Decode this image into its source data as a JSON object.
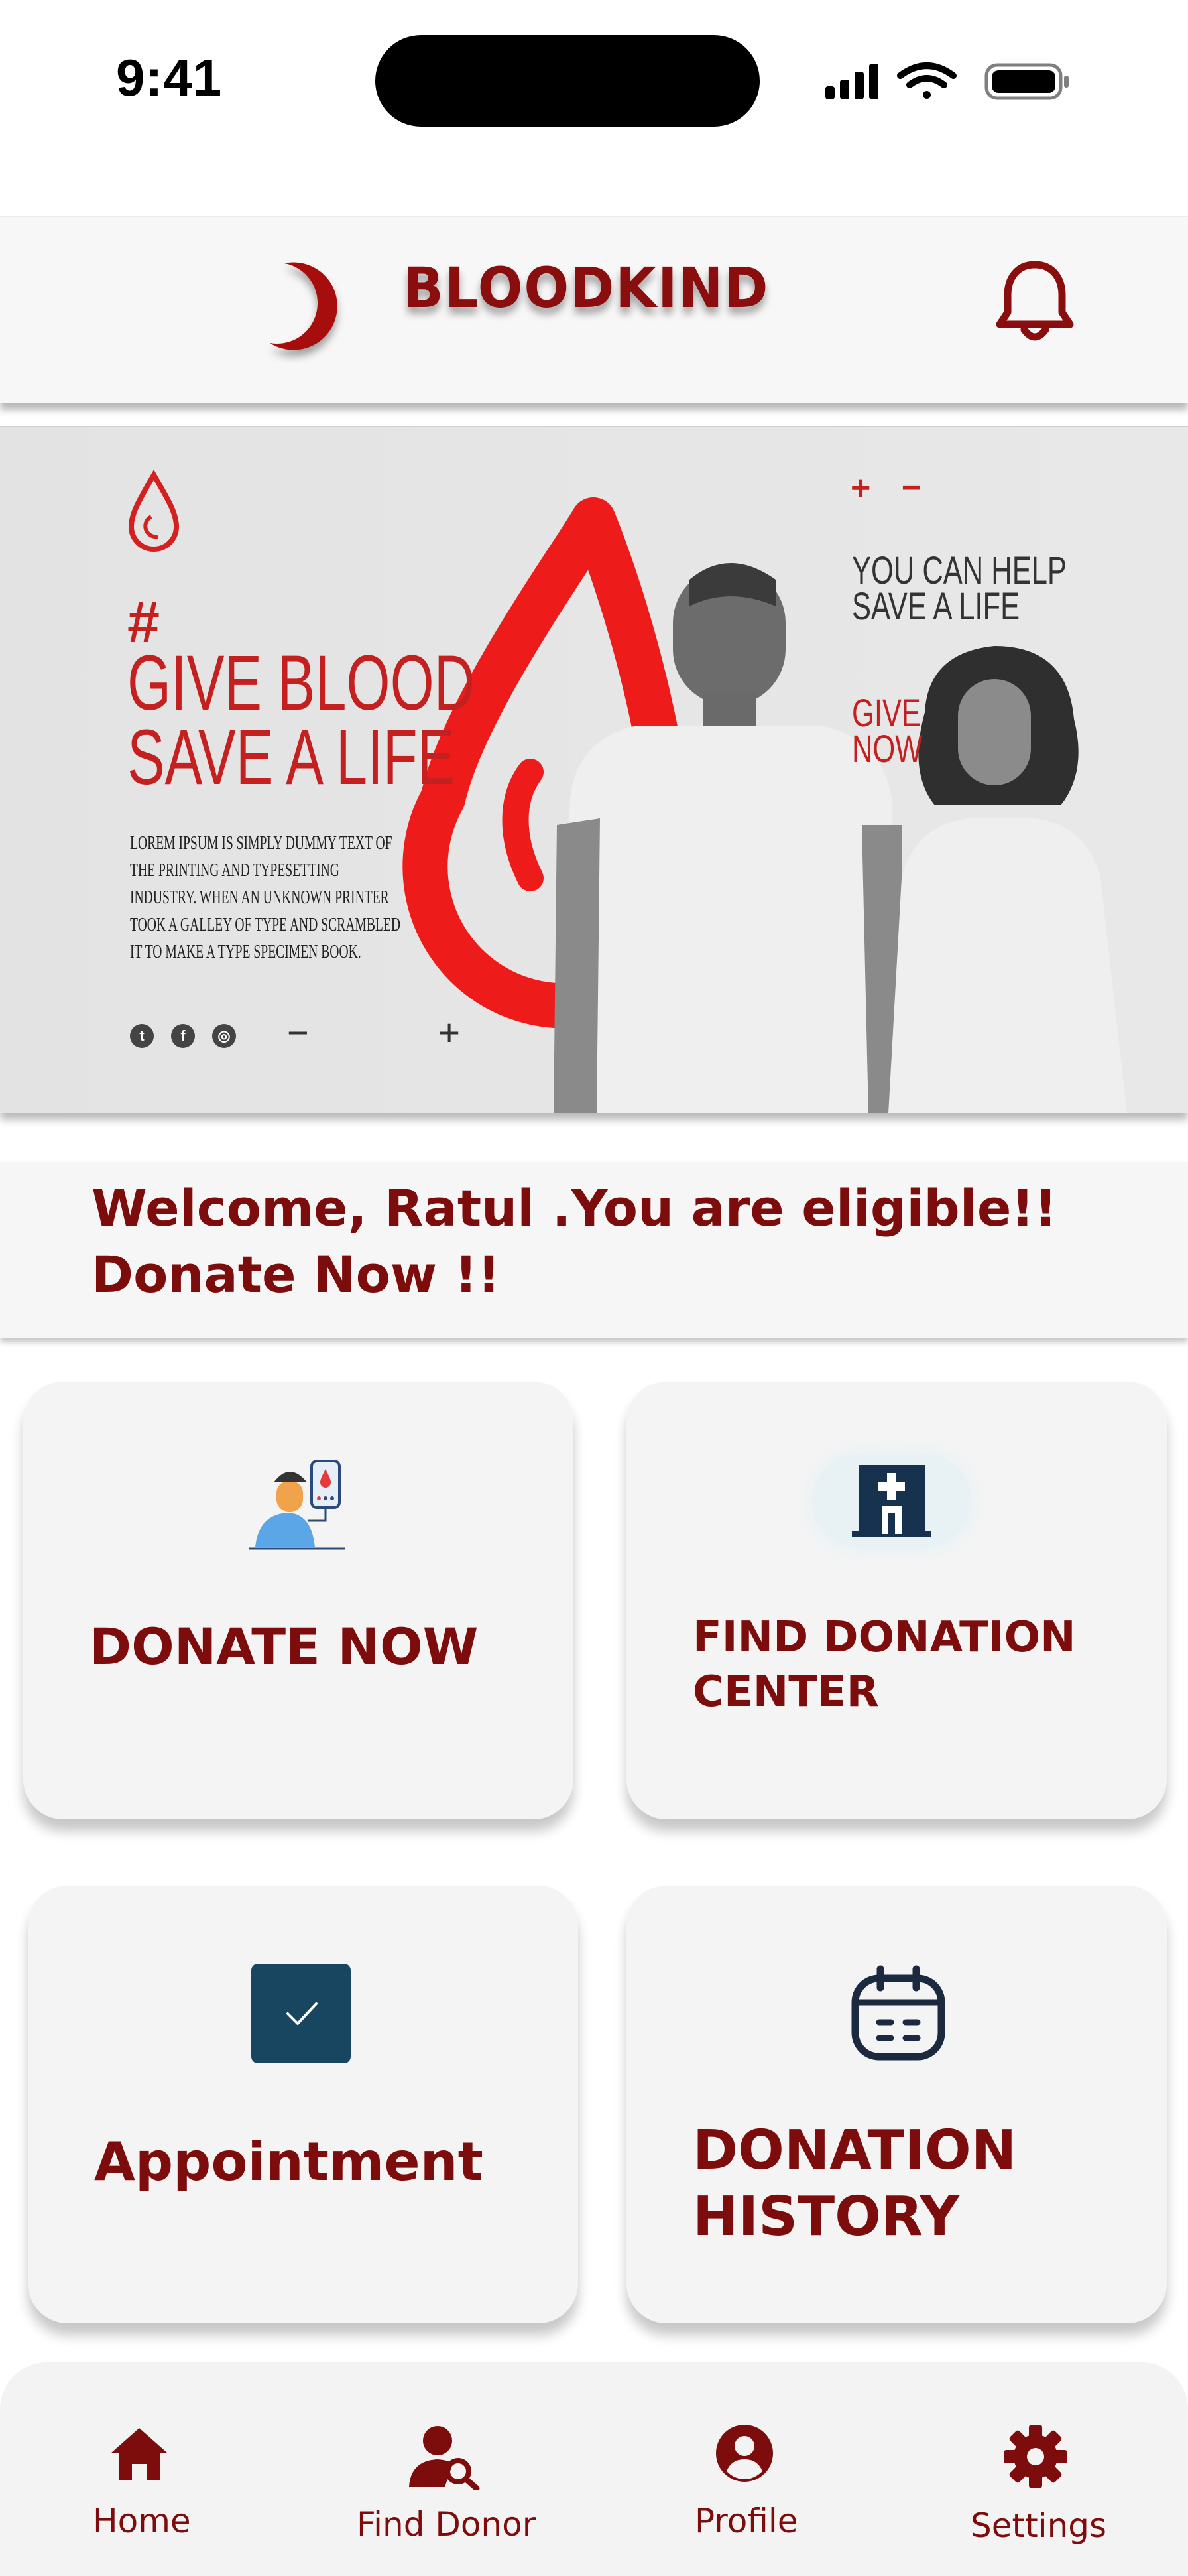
{
  "status_bar": {
    "time": "9:41"
  },
  "header": {
    "title": "BLOODKIND"
  },
  "banner": {
    "hashtag": "#",
    "headline_line1": "GIVE BLOOD",
    "headline_line2": "SAVE A LIFE",
    "body": "LOREM IPSUM IS SIMPLY DUMMY TEXT OF THE PRINTING AND TYPESETTING INDUSTRY. WHEN AN UNKNOWN PRINTER TOOK A GALLEY OF TYPE AND SCRAMBLED IT TO MAKE A TYPE SPECIMEN BOOK.",
    "right_text": "YOU CAN HELP SAVE A LIFE",
    "cta": "GIVE NOW",
    "plus_minus": "+ −",
    "controls": "− +"
  },
  "welcome": {
    "line1": "Welcome, Ratul .You are eligible!!",
    "line2": "Donate Now !!"
  },
  "tiles": {
    "donate_now": "DONATE NOW",
    "find_center_line1": "FIND DONATION",
    "find_center_line2": "CENTER",
    "appointment": "Appointment",
    "history_line1": "DONATION",
    "history_line2": "HISTORY"
  },
  "bottom_nav": [
    {
      "label": "Home",
      "icon": "home-icon"
    },
    {
      "label": "Find Donor",
      "icon": "find-donor-icon"
    },
    {
      "label": "Profile",
      "icon": "profile-icon"
    },
    {
      "label": "Settings",
      "icon": "gear-icon"
    }
  ],
  "colors": {
    "brand": "#7d0c0c",
    "accent_red": "#e31e1e",
    "card": "#f5f4f4"
  }
}
